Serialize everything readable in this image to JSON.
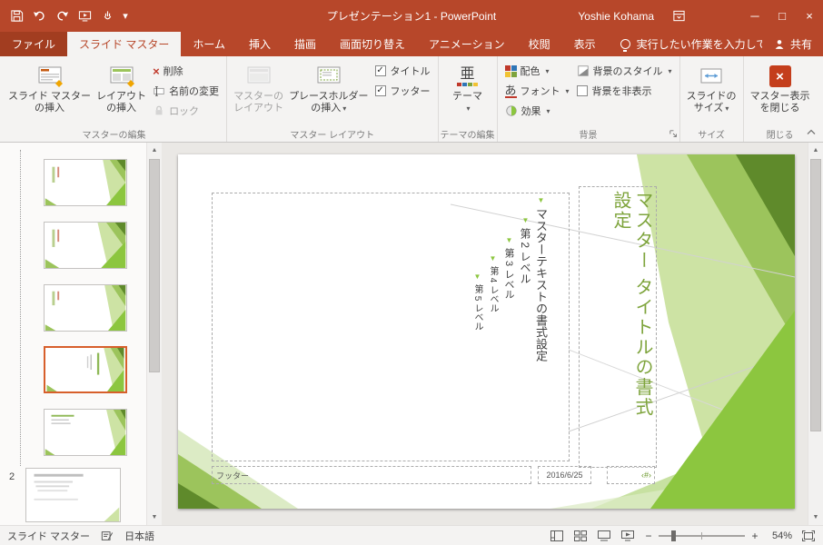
{
  "icons": {
    "dropdown": "▾",
    "check": "✓",
    "bullet": "▼",
    "close": "×",
    "minimize": "─",
    "maximize": "□",
    "scroll_up": "▲",
    "scroll_down": "▼",
    "minus": "−",
    "plus": "+",
    "theme_glyph": "亜",
    "fonts_glyph": "あ"
  },
  "titlebar": {
    "title": "プレゼンテーション1 - PowerPoint",
    "user": "Yoshie Kohama"
  },
  "tabs": {
    "file": "ファイル",
    "items": [
      {
        "label": "スライド マスター"
      },
      {
        "label": "ホーム"
      },
      {
        "label": "挿入"
      },
      {
        "label": "描画"
      },
      {
        "label": "画面切り替え"
      },
      {
        "label": "アニメーション"
      },
      {
        "label": "校閲"
      },
      {
        "label": "表示"
      }
    ],
    "tellme": "実行したい作業を入力してください",
    "share": "共有"
  },
  "ribbon": {
    "edit_master": {
      "label": "マスターの編集",
      "insert_master_l1": "スライド マスター",
      "insert_master_l2": "の挿入",
      "insert_layout_l1": "レイアウト",
      "insert_layout_l2": "の挿入",
      "delete": "削除",
      "rename": "名前の変更",
      "lock": "ロック"
    },
    "master_layout": {
      "label": "マスター レイアウト",
      "master_layout_l1": "マスターの",
      "master_layout_l2": "レイアウト",
      "insert_placeholder_l1": "プレースホルダー",
      "insert_placeholder_l2": "の挿入",
      "title_checkbox": "タイトル",
      "footer_checkbox": "フッター"
    },
    "edit_theme": {
      "label": "テーマの編集",
      "themes": "テーマ"
    },
    "background": {
      "label": "背景",
      "colors": "配色",
      "fonts": "フォント",
      "effects": "効果",
      "bg_styles": "背景のスタイル",
      "hide_bg": "背景を非表示"
    },
    "size": {
      "label": "サイズ",
      "slide_size_l1": "スライドの",
      "slide_size_l2": "サイズ"
    },
    "close": {
      "label": "閉じる",
      "close_master_l1": "マスター表示",
      "close_master_l2": "を閉じる"
    }
  },
  "thumbnails": {
    "master_number": "2"
  },
  "slide": {
    "title": "マスター タイトルの書式設定",
    "body_levels": [
      "マスターテキストの書式設定",
      "第 2 レベル",
      "第 3 レベル",
      "第 4 レベル",
      "第 5 レベル"
    ],
    "footer": "フッター",
    "date": "2016/6/25",
    "number": "‹#›"
  },
  "statusbar": {
    "view_label": "スライド マスター",
    "language": "日本語",
    "zoom": "54%"
  }
}
